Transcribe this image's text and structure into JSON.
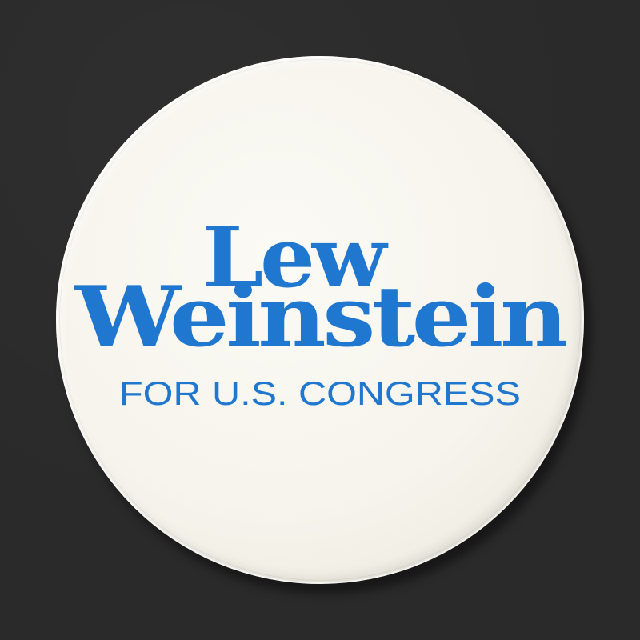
{
  "button": {
    "name_line1": "Lew",
    "name_line2": "Weinstein",
    "tagline": "FOR U.S. CONGRESS"
  },
  "colors": {
    "ink_blue": "#1f77d0",
    "button_white": "#f6f4ec",
    "background": "#2a2a2a"
  }
}
